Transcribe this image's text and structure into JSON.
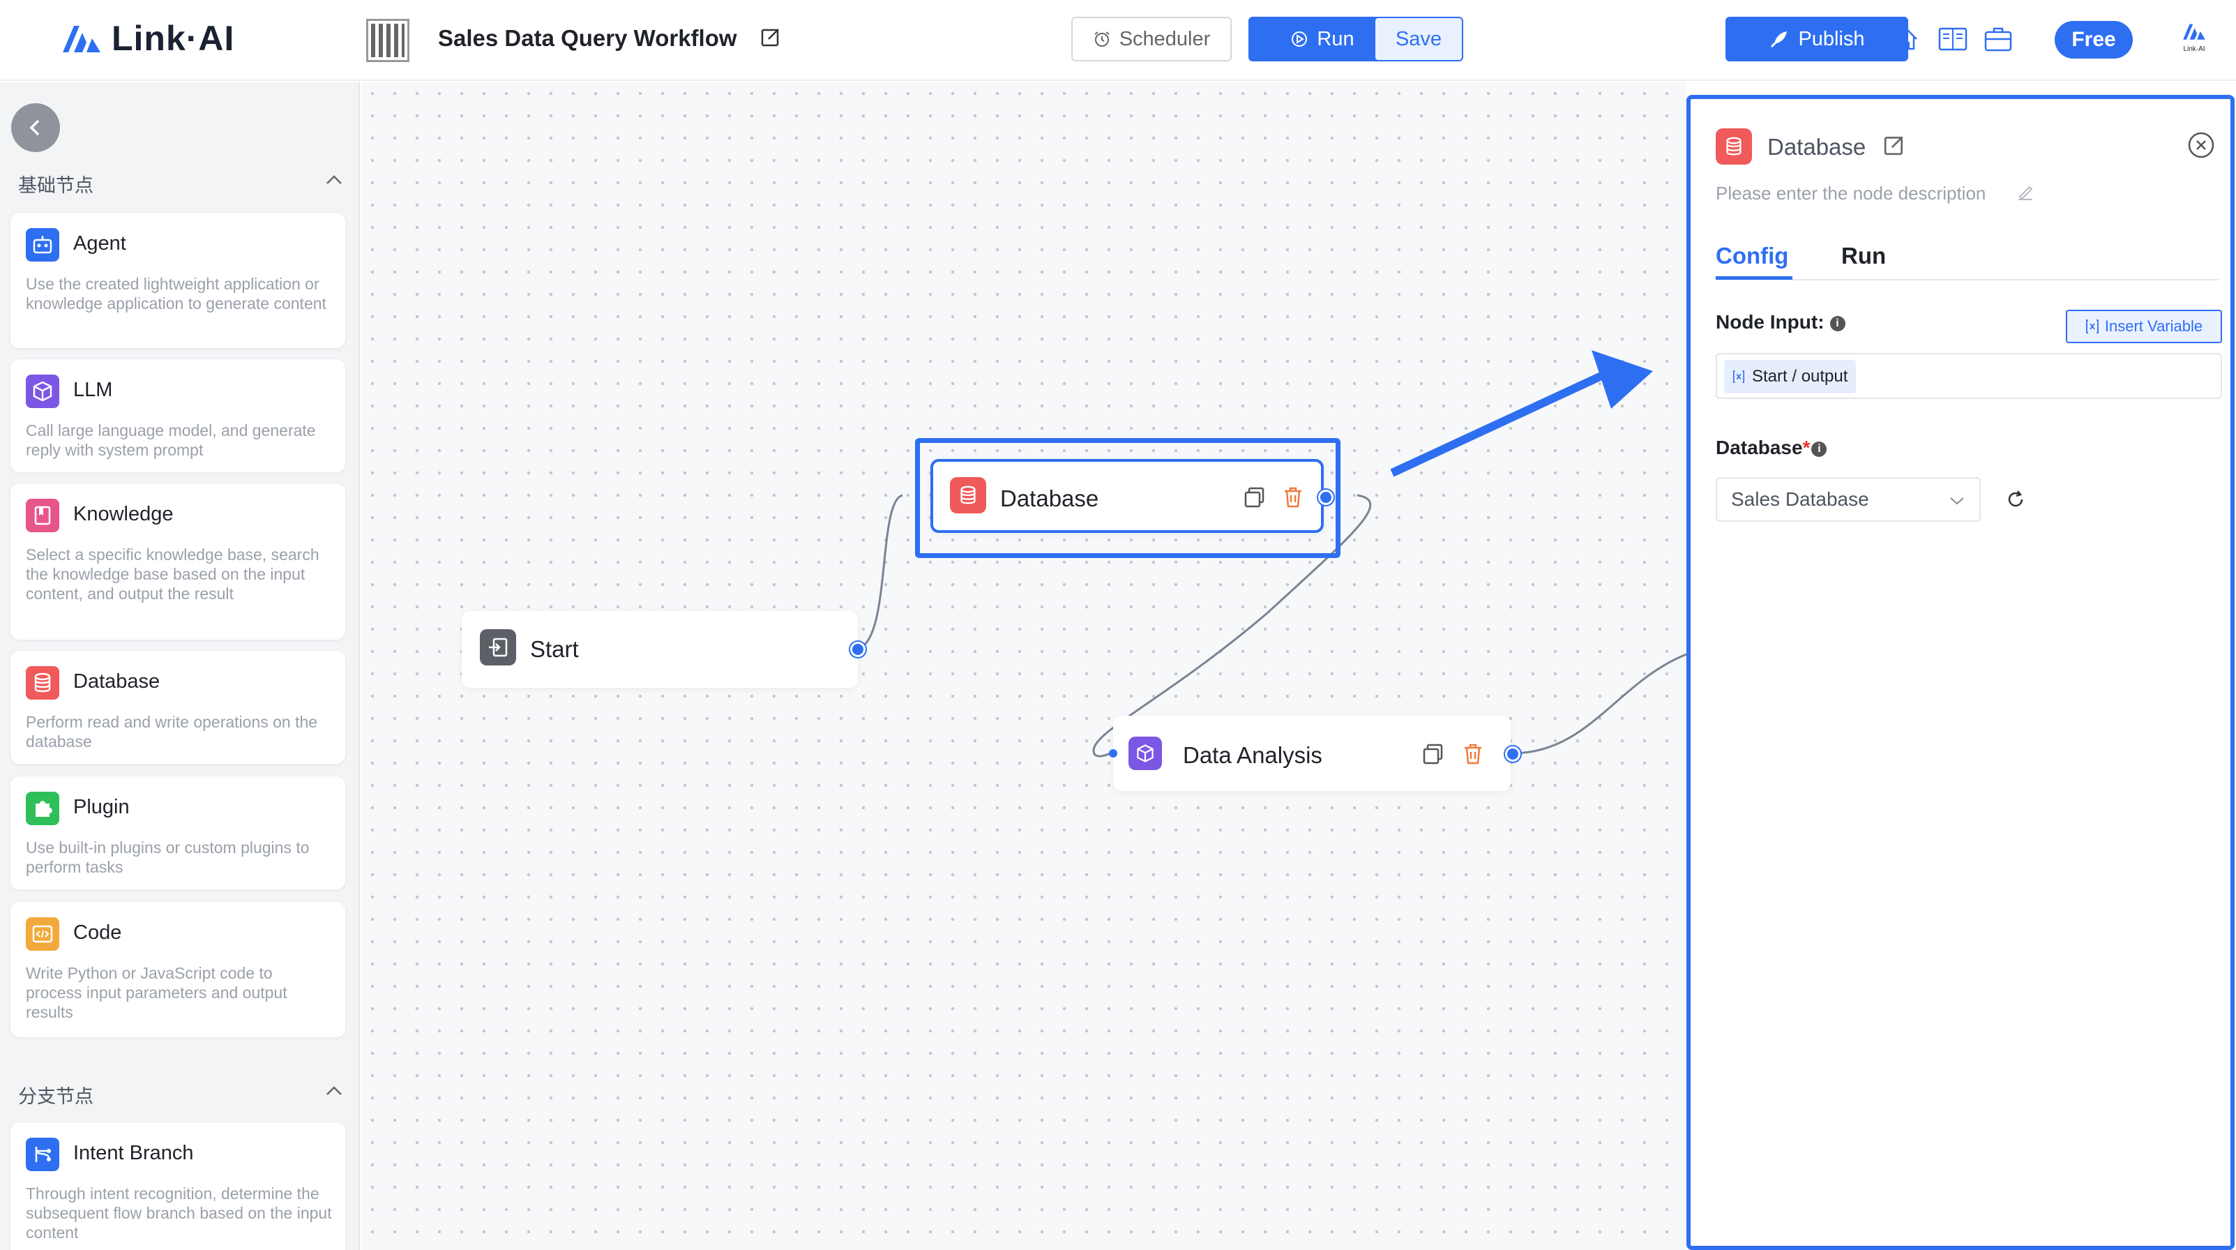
{
  "header": {
    "logo_text": "Link·AI",
    "workflow_title": "Sales Data Query Workflow",
    "scheduler_label": "Scheduler",
    "run_label": "Run",
    "save_label": "Save",
    "publish_label": "Publish",
    "free_label": "Free",
    "mini_logo_text": "Link·AI"
  },
  "sidebar": {
    "section_basic": "基础节点",
    "section_branch": "分支节点",
    "nodes": [
      {
        "title": "Agent",
        "desc": "Use the created lightweight application or knowledge application to generate content",
        "icon": "robot-icon",
        "color": "#2e6ff2"
      },
      {
        "title": "LLM",
        "desc": "Call large language model, and generate reply with system prompt",
        "icon": "cube-icon",
        "color": "#7b57e4"
      },
      {
        "title": "Knowledge",
        "desc": "Select a specific knowledge base, search the knowledge base based on the input content, and output the result",
        "icon": "book-icon",
        "color": "#e8558a"
      },
      {
        "title": "Database",
        "desc": "Perform read and write operations on the database",
        "icon": "database-icon",
        "color": "#f05a5a"
      },
      {
        "title": "Plugin",
        "desc": "Use built-in plugins or custom plugins to perform tasks",
        "icon": "puzzle-icon",
        "color": "#2fbf5a"
      },
      {
        "title": "Code",
        "desc": "Write Python or JavaScript code to process input parameters and output results",
        "icon": "code-icon",
        "color": "#f2a93b"
      }
    ],
    "branch_nodes": [
      {
        "title": "Intent Branch",
        "desc": "Through intent recognition, determine the subsequent flow branch based on the input content",
        "icon": "branch-icon",
        "color": "#2e6ff2"
      }
    ]
  },
  "canvas": {
    "start_label": "Start",
    "database_label": "Database",
    "analysis_label": "Data Analysis"
  },
  "panel": {
    "title": "Database",
    "desc_placeholder": "Please enter the node description",
    "tab_config": "Config",
    "tab_run": "Run",
    "node_input_label": "Node Input:",
    "insert_variable": "Insert Variable",
    "input_chip": "Start / output",
    "database_label": "Database",
    "required_mark": "*",
    "database_selected": "Sales Database"
  }
}
